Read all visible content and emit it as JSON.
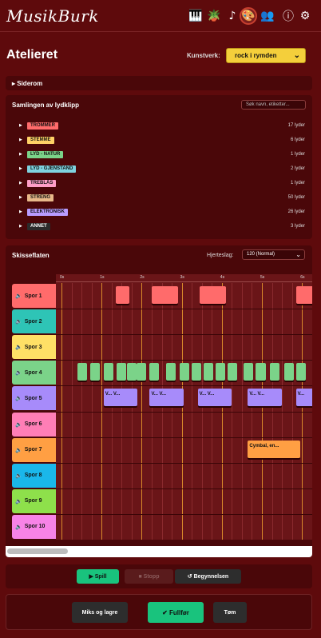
{
  "app": {
    "logo": "MusikBurk"
  },
  "topnav": [
    {
      "name": "piano-icon",
      "glyph": "🎹"
    },
    {
      "name": "plant-icon",
      "glyph": "🪴"
    },
    {
      "name": "notes-icon",
      "glyph": "♪"
    },
    {
      "name": "palette-icon",
      "glyph": "🎨"
    },
    {
      "name": "people-icon",
      "glyph": "👥"
    },
    {
      "name": "info-icon",
      "glyph": "ⓘ"
    },
    {
      "name": "gear-icon",
      "glyph": "⚙"
    }
  ],
  "page": {
    "title": "Atelieret",
    "kunstverk_label": "Kunstverk:",
    "kunstverk_value": "rock i rymden"
  },
  "siderom": {
    "title": "Siderom"
  },
  "samling": {
    "title": "Samlingen av lydklipp",
    "search_placeholder": "Søk navn, etiketter...",
    "categories": [
      {
        "label": "TROMMER",
        "count": "17 lyder",
        "color": "#ff6b6b"
      },
      {
        "label": "STEMME",
        "count": "6 lyder",
        "color": "#ffd166"
      },
      {
        "label": "LYD - NATUR",
        "count": "1 lyder",
        "color": "#7bd389"
      },
      {
        "label": "LYD - GJENSTAND",
        "count": "2 lyder",
        "color": "#7fd3e0"
      },
      {
        "label": "TREBLÅS",
        "count": "1 lyder",
        "color": "#ff9ec7"
      },
      {
        "label": "STRENG",
        "count": "50 lyder",
        "color": "#e8b98a"
      },
      {
        "label": "ELEKTRONISK",
        "count": "26 lyder",
        "color": "#b99cff"
      },
      {
        "label": "ANNET",
        "count": "3 lyder",
        "color": "#2b2b2b"
      }
    ]
  },
  "skisse": {
    "title": "Skisseflaten",
    "hjerteslag_label": "Hjerteslag:",
    "hjerteslag_value": "120 (Normal)",
    "ticks": [
      "0s",
      "1s",
      "2s",
      "3s",
      "4s",
      "5s",
      "6s"
    ],
    "tracks": [
      {
        "label": "Spor 1",
        "color": "#ff6b6b"
      },
      {
        "label": "Spor 2",
        "color": "#2ec4b6"
      },
      {
        "label": "Spor 3",
        "color": "#ffe066"
      },
      {
        "label": "Spor 4",
        "color": "#7bd389"
      },
      {
        "label": "Spor 5",
        "color": "#a78bfa"
      },
      {
        "label": "Spor 6",
        "color": "#ff7eb6"
      },
      {
        "label": "Spor 7",
        "color": "#ff9f43"
      },
      {
        "label": "Spor 8",
        "color": "#1ab7ea"
      },
      {
        "label": "Spor 9",
        "color": "#8ee04b"
      },
      {
        "label": "Spor 10",
        "color": "#f783e7"
      }
    ],
    "clips": [
      {
        "track": 0,
        "start": 1.35,
        "dur": 0.35,
        "label": ""
      },
      {
        "track": 0,
        "start": 2.25,
        "dur": 0.65,
        "label": ""
      },
      {
        "track": 0,
        "start": 3.45,
        "dur": 0.65,
        "label": ""
      },
      {
        "track": 0,
        "start": 5.85,
        "dur": 0.6,
        "label": ""
      },
      {
        "track": 3,
        "start": 0.4,
        "dur": 0.24,
        "label": ""
      },
      {
        "track": 3,
        "start": 0.72,
        "dur": 0.24,
        "label": ""
      },
      {
        "track": 3,
        "start": 1.05,
        "dur": 0.24,
        "label": ""
      },
      {
        "track": 3,
        "start": 1.37,
        "dur": 0.24,
        "label": ""
      },
      {
        "track": 3,
        "start": 1.63,
        "dur": 0.24,
        "label": ""
      },
      {
        "track": 3,
        "start": 1.88,
        "dur": 0.24,
        "label": ""
      },
      {
        "track": 3,
        "start": 2.2,
        "dur": 0.24,
        "label": ""
      },
      {
        "track": 3,
        "start": 2.6,
        "dur": 0.24,
        "label": ""
      },
      {
        "track": 3,
        "start": 2.95,
        "dur": 0.24,
        "label": ""
      },
      {
        "track": 3,
        "start": 3.25,
        "dur": 0.24,
        "label": ""
      },
      {
        "track": 3,
        "start": 3.55,
        "dur": 0.24,
        "label": ""
      },
      {
        "track": 3,
        "start": 3.85,
        "dur": 0.24,
        "label": ""
      },
      {
        "track": 3,
        "start": 4.15,
        "dur": 0.24,
        "label": ""
      },
      {
        "track": 3,
        "start": 4.55,
        "dur": 0.24,
        "label": ""
      },
      {
        "track": 3,
        "start": 4.85,
        "dur": 0.24,
        "label": ""
      },
      {
        "track": 3,
        "start": 5.2,
        "dur": 0.24,
        "label": ""
      },
      {
        "track": 3,
        "start": 5.55,
        "dur": 0.24,
        "label": ""
      },
      {
        "track": 3,
        "start": 5.85,
        "dur": 0.24,
        "label": ""
      },
      {
        "track": 4,
        "start": 1.05,
        "dur": 0.85,
        "label": "V... V..."
      },
      {
        "track": 4,
        "start": 2.2,
        "dur": 0.85,
        "label": "V... V..."
      },
      {
        "track": 4,
        "start": 3.4,
        "dur": 0.85,
        "label": "V... V..."
      },
      {
        "track": 4,
        "start": 4.65,
        "dur": 0.85,
        "label": "V... V..."
      },
      {
        "track": 4,
        "start": 5.85,
        "dur": 0.6,
        "label": "V..."
      },
      {
        "track": 6,
        "start": 4.65,
        "dur": 1.3,
        "label": "Cymbal, en..."
      }
    ]
  },
  "transport": {
    "play": "▶ Spill",
    "stop": "■ Stopp",
    "begin": "↺ Begynnelsen"
  },
  "actions": {
    "mix": "Miks og lagre",
    "finish": "✔ Fullfør",
    "clear": "Tøm"
  }
}
